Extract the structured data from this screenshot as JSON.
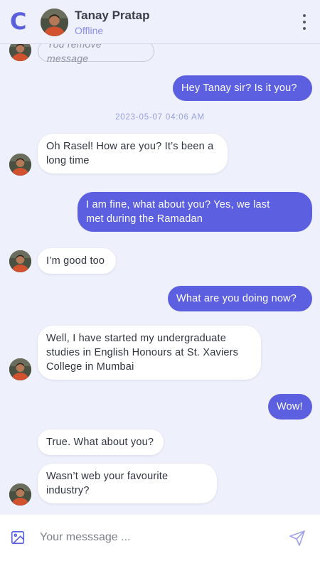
{
  "app": {
    "logo_letter": "C"
  },
  "header": {
    "contact_name": "Tanay Pratap",
    "status": "Offline",
    "menu_icon": "more-vertical-icon"
  },
  "messages": [
    {
      "id": "m0",
      "direction": "in",
      "text": "You remove message",
      "removed": true
    },
    {
      "id": "m1",
      "direction": "out",
      "text": "Hey Tanay sir? Is it you?"
    },
    {
      "id": "ts1",
      "type": "timestamp",
      "text": "2023-05-07 04:06 AM"
    },
    {
      "id": "m2",
      "direction": "in",
      "lines": [
        "Oh Rasel! How are you? It’s been a",
        "long time"
      ]
    },
    {
      "id": "m3",
      "direction": "out",
      "lines": [
        "I am fine, what about you? Yes, we last",
        "met during the Ramadan"
      ]
    },
    {
      "id": "m4",
      "direction": "in",
      "text": "I’m good too"
    },
    {
      "id": "m5",
      "direction": "out",
      "text": "What are you doing now?"
    },
    {
      "id": "m6",
      "direction": "in",
      "lines": [
        "Well, I have started my undergraduate",
        "studies in English Honours at St. Xaviers",
        "College in Mumbai"
      ]
    },
    {
      "id": "m7",
      "direction": "out",
      "text": "Wow!"
    },
    {
      "id": "m8",
      "direction": "in",
      "text": "True. What about you?"
    },
    {
      "id": "m9",
      "direction": "in",
      "lines": [
        "Wasn’t web your favourite",
        "industry?"
      ]
    }
  ],
  "composer": {
    "placeholder": "Your messsage ...",
    "attach_icon": "image-icon",
    "send_icon": "send-icon"
  },
  "colors": {
    "accent": "#5b5fe0",
    "background": "#eef0fb",
    "status": "#8b90e8"
  }
}
